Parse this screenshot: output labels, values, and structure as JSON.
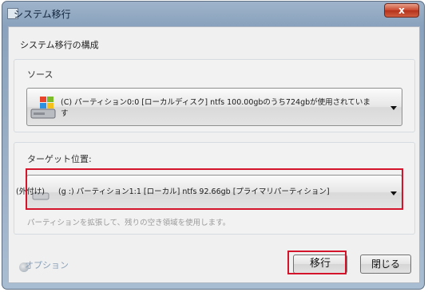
{
  "window": {
    "title": "システム移行",
    "close_label": "x"
  },
  "dialog": {
    "heading": "システム移行の構成"
  },
  "source": {
    "title": "ソース",
    "value_line1": "(C) パーティション0:0 [ローカルディスク] ntfs 100.00gbのうち724gbが使用されていま",
    "value_line2": "す",
    "icon": "windows-disk-icon"
  },
  "target": {
    "title": "ターゲット位置:",
    "prefix": "(外付け)",
    "value": "(g :) パーティション1:1 [ローカル] ntfs 92.66gb [プライマリパーティション]",
    "hint": "パーティションを拡張して、残りの空き領域を使用します。",
    "icon": "external-disk-icon"
  },
  "footer": {
    "options_label": "オプション",
    "migrate_label": "移行",
    "close_label": "閉じる"
  },
  "colors": {
    "highlight_red": "#d4142a",
    "title_bar": "#8aa2bd",
    "close_button": "#c9462c"
  }
}
